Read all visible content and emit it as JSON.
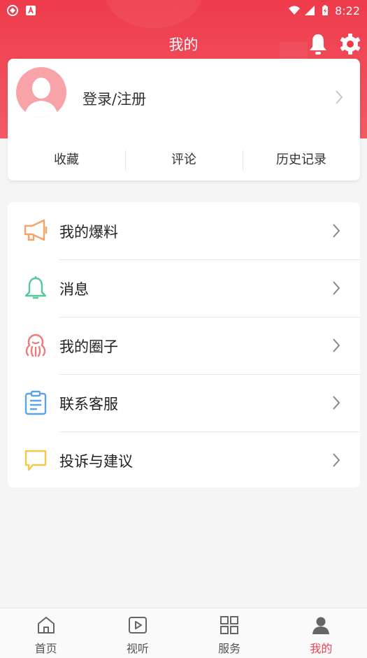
{
  "status_bar": {
    "time": "8:22"
  },
  "header": {
    "title": "我的"
  },
  "profile": {
    "login_label": "登录/注册",
    "quick_links": [
      {
        "label": "收藏"
      },
      {
        "label": "评论"
      },
      {
        "label": "历史记录"
      }
    ]
  },
  "menu": {
    "items": [
      {
        "label": "我的爆料",
        "icon": "megaphone-icon",
        "color": "#f5a367"
      },
      {
        "label": "消息",
        "icon": "bell-icon",
        "color": "#55c89a"
      },
      {
        "label": "我的圈子",
        "icon": "octopus-icon",
        "color": "#f07a7a"
      },
      {
        "label": "联系客服",
        "icon": "clipboard-icon",
        "color": "#5aa5e8"
      },
      {
        "label": "投诉与建议",
        "icon": "chat-bubble-icon",
        "color": "#f5c84a"
      }
    ]
  },
  "tabbar": {
    "tabs": [
      {
        "label": "首页",
        "icon": "home-icon"
      },
      {
        "label": "视听",
        "icon": "play-icon"
      },
      {
        "label": "服务",
        "icon": "grid-icon"
      },
      {
        "label": "我的",
        "icon": "user-icon",
        "active": true
      }
    ]
  },
  "colors": {
    "brand": "#ee3b4c",
    "active_tab": "#e94453"
  }
}
